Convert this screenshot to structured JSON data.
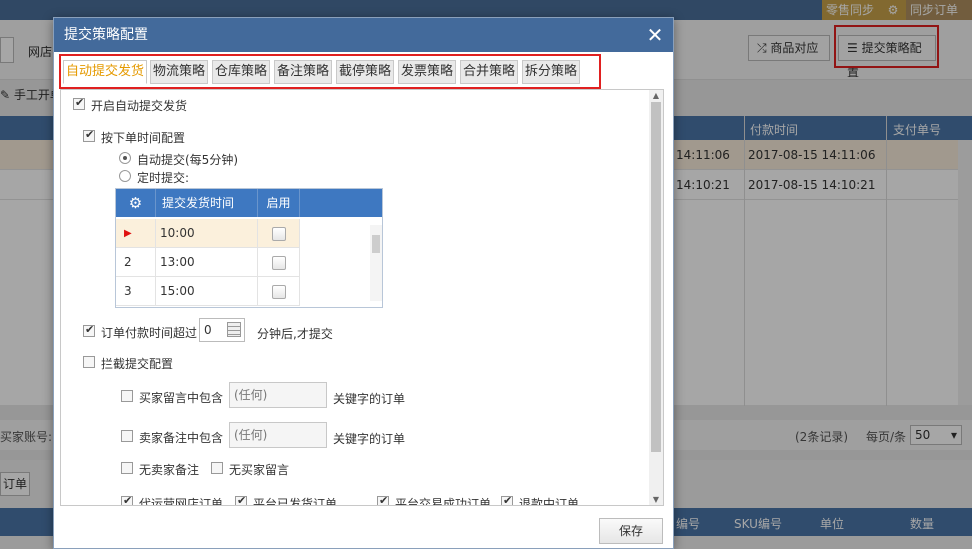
{
  "background": {
    "topbar": {
      "sync_retail": "零售同步",
      "sync_order": "同步订单"
    },
    "filter": {
      "shop_label": "网店",
      "product_match": "商品对应",
      "strategy_config": "提交策略配置"
    },
    "manual_order": "手工开单",
    "grid_headers": {
      "pay_time": "付款时间",
      "pay_no": "支付单号"
    },
    "rows": [
      {
        "time_a": "14:11:06",
        "pay_time": "2017-08-15 14:11:06"
      },
      {
        "time_a": "14:10:21",
        "pay_time": "2017-08-15 14:10:21"
      }
    ],
    "pager": {
      "account_label": "买家账号:",
      "records": "(2条记录)",
      "per_page": "每页/条",
      "page_size": "50"
    },
    "lower_tab": "订单",
    "lower_headers": {
      "no": "编号",
      "sku": "SKU编号",
      "unit": "单位",
      "qty": "数量"
    }
  },
  "dialog": {
    "title": "提交策略配置",
    "tabs": [
      {
        "label": "自动提交发货",
        "active": true
      },
      {
        "label": "物流策略",
        "active": false
      },
      {
        "label": "仓库策略",
        "active": false
      },
      {
        "label": "备注策略",
        "active": false
      },
      {
        "label": "截停策略",
        "active": false
      },
      {
        "label": "发票策略",
        "active": false
      },
      {
        "label": "合并策略",
        "active": false
      },
      {
        "label": "拆分策略",
        "active": false
      }
    ],
    "enable_auto": "开启自动提交发货",
    "by_order_time": "按下单时间配置",
    "radio_auto": "自动提交(每5分钟)",
    "radio_timed": "定时提交:",
    "schedule": {
      "head_time": "提交发货时间",
      "head_enable": "启用",
      "rows": [
        {
          "num": "▶",
          "time": "10:00"
        },
        {
          "num": "2",
          "time": "13:00"
        },
        {
          "num": "3",
          "time": "15:00"
        }
      ]
    },
    "pay_timeout": {
      "label": "订单付款时间超过",
      "value": "0",
      "suffix": "分钟后,才提交"
    },
    "intercept": "拦截提交配置",
    "buyer_msg": {
      "label": "买家留言中包含",
      "placeholder": "(任何)",
      "suffix": "关键字的订单"
    },
    "seller_note": {
      "label": "卖家备注中包含",
      "placeholder": "(任何)",
      "suffix": "关键字的订单"
    },
    "no_seller_note": "无卖家备注",
    "no_buyer_msg": "无买家留言",
    "bottom_row": {
      "a": "代运营网店订单",
      "b": "平台已发货订单",
      "c": "平台交易成功订单",
      "d": "退款中订单"
    },
    "save": "保存"
  }
}
